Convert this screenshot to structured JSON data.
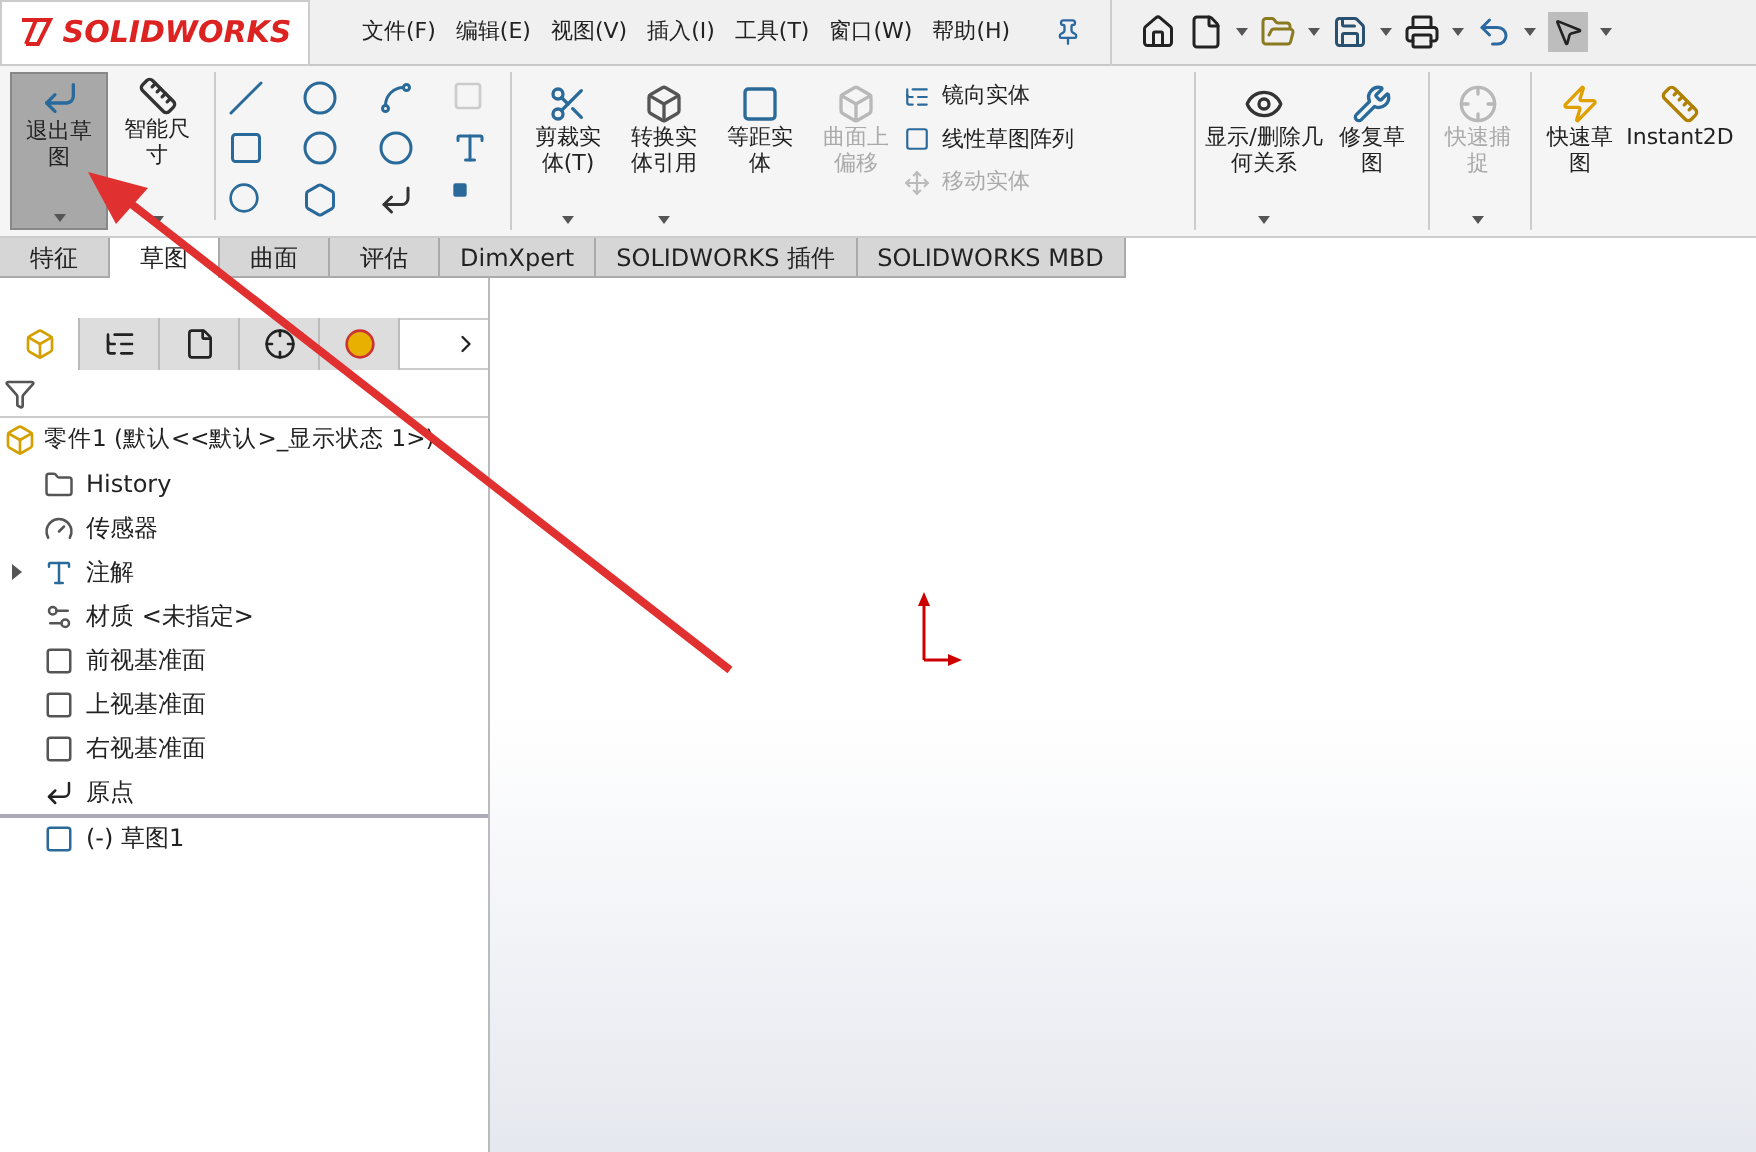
{
  "logo": {
    "text": "SOLIDWORKS"
  },
  "menu": [
    "文件(F)",
    "编辑(E)",
    "视图(V)",
    "插入(I)",
    "工具(T)",
    "窗口(W)",
    "帮助(H)"
  ],
  "ribbon_left": [
    {
      "label": "退出草图",
      "selected": true,
      "kind": "exit"
    },
    {
      "label": "智能尺寸",
      "selected": false,
      "kind": "dim"
    }
  ],
  "panel_tabs": [
    {
      "kind": "part",
      "selected": true
    },
    {
      "kind": "tree",
      "selected": false
    },
    {
      "kind": "config",
      "selected": false
    },
    {
      "kind": "target",
      "selected": false
    },
    {
      "kind": "appearance",
      "selected": false
    }
  ],
  "ribbon_mid": [
    {
      "label": "剪裁实体(T)",
      "disabled": false,
      "kind": "trim",
      "caret": true
    },
    {
      "label": "转换实体引用",
      "disabled": false,
      "kind": "convert",
      "caret": true
    },
    {
      "label": "等距实体",
      "disabled": false,
      "kind": "offset",
      "caret": false
    },
    {
      "label": "曲面上偏移",
      "disabled": true,
      "kind": "surface",
      "caret": false
    }
  ],
  "ribbon_list": [
    {
      "label": "镜向实体",
      "disabled": false,
      "kind": "mirror"
    },
    {
      "label": "线性草图阵列",
      "disabled": false,
      "kind": "pattern"
    },
    {
      "label": "移动实体",
      "disabled": true,
      "kind": "move"
    }
  ],
  "ribbon_right": [
    {
      "label": "显示/删除几何关系",
      "disabled": false,
      "kind": "relations",
      "caret": true,
      "sep": true
    },
    {
      "label": "修复草图",
      "disabled": false,
      "kind": "repair",
      "caret": false,
      "sep": false
    },
    {
      "label": "快速捕捉",
      "disabled": true,
      "kind": "snap",
      "caret": true,
      "sep": true
    },
    {
      "label": "快速草图",
      "disabled": false,
      "kind": "quick",
      "caret": false,
      "sep": true
    },
    {
      "label": "Instant2D",
      "disabled": false,
      "kind": "instant",
      "caret": false,
      "sep": false
    }
  ],
  "tabs": [
    {
      "label": "特征",
      "selected": false
    },
    {
      "label": "草图",
      "selected": true
    },
    {
      "label": "曲面",
      "selected": false
    },
    {
      "label": "评估",
      "selected": false
    },
    {
      "label": "DimXpert",
      "selected": false
    },
    {
      "label": "SOLIDWORKS 插件",
      "selected": false
    },
    {
      "label": "SOLIDWORKS MBD",
      "selected": false
    }
  ],
  "tree": {
    "root": "零件1  (默认<<默认>_显示状态 1>)",
    "items": [
      {
        "label": "History",
        "kind": "history",
        "expandable": false
      },
      {
        "label": "传感器",
        "kind": "sensor",
        "expandable": false
      },
      {
        "label": "注解",
        "kind": "annotation",
        "expandable": true
      },
      {
        "label": "材质 <未指定>",
        "kind": "material",
        "expandable": false
      },
      {
        "label": "前视基准面",
        "kind": "plane",
        "expandable": false
      },
      {
        "label": "上视基准面",
        "kind": "plane",
        "expandable": false
      },
      {
        "label": "右视基准面",
        "kind": "plane",
        "expandable": false
      },
      {
        "label": "原点",
        "kind": "origin",
        "expandable": false
      },
      {
        "label": "(-) 草图1",
        "kind": "sketch",
        "expandable": false
      }
    ]
  }
}
